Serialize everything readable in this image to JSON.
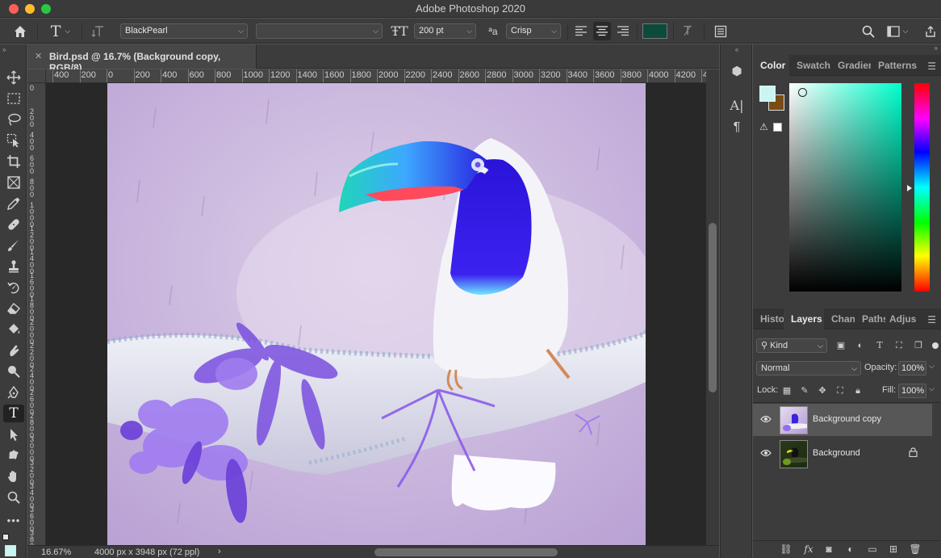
{
  "window": {
    "title": "Adobe Photoshop 2020"
  },
  "options_bar": {
    "font_family": "BlackPearl",
    "font_style": "",
    "font_size": "200 pt",
    "antialias": "Crisp",
    "text_color": "#0c4a3c"
  },
  "toolbar": {
    "tools": [
      "move-tool",
      "marquee-tool",
      "lasso-tool",
      "object-select-tool",
      "crop-tool",
      "frame-tool",
      "eyedropper-tool",
      "healing-brush-tool",
      "brush-tool",
      "clone-stamp-tool",
      "history-brush-tool",
      "eraser-tool",
      "paint-bucket-tool",
      "smudge-tool",
      "dodge-tool",
      "pen-tool",
      "type-tool",
      "path-select-tool",
      "shape-tool",
      "hand-tool",
      "zoom-tool",
      "more-tools"
    ],
    "active_tool": "type-tool"
  },
  "document": {
    "tab_title": "Bird.psd @ 16.7% (Background copy, RGB/8)",
    "ruler_h": [
      "400",
      "200",
      "0",
      "200",
      "400",
      "600",
      "800",
      "1000",
      "1200",
      "1400",
      "1600",
      "1800",
      "2000",
      "2200",
      "2400",
      "2600",
      "2800",
      "3000",
      "3200",
      "3400",
      "3600",
      "3800",
      "4000",
      "4200",
      "4"
    ],
    "ruler_v": [
      "0",
      "200",
      "400",
      "600",
      "800",
      "1000",
      "1200",
      "1400",
      "1600",
      "1800",
      "2000",
      "2200",
      "2400",
      "2600",
      "2800",
      "3000",
      "3200",
      "3400",
      "3600",
      "3800"
    ]
  },
  "status": {
    "zoom": "16.67%",
    "dimensions": "4000 px x 3948 px (72 ppl)"
  },
  "color_panel": {
    "tabs": [
      "Color",
      "Swatche",
      "Gradien",
      "Patterns"
    ],
    "active_tab": "Color",
    "foreground": "#c9f6f3",
    "background": "#7a4c14"
  },
  "layers_panel": {
    "tabs": [
      "Histo",
      "Layers",
      "Chan",
      "Paths",
      "Adjus"
    ],
    "active_tab": "Layers",
    "kind_label": "Kind",
    "blend_mode": "Normal",
    "opacity_label": "Opacity:",
    "opacity_value": "100%",
    "lock_label": "Lock:",
    "fill_label": "Fill:",
    "fill_value": "100%",
    "layers": [
      {
        "name": "Background copy",
        "selected": true,
        "locked": false
      },
      {
        "name": "Background",
        "selected": false,
        "locked": true
      }
    ]
  }
}
